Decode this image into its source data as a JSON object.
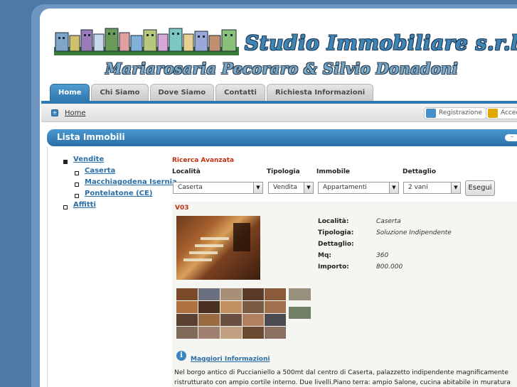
{
  "header": {
    "title": "Studio Immobiliare s.r.l.",
    "subtitle": "Mariarosaria Pecoraro & Silvio Donadoni"
  },
  "tabs": [
    {
      "label": "Home",
      "active": true
    },
    {
      "label": "Chi Siamo"
    },
    {
      "label": "Dove Siamo"
    },
    {
      "label": "Contatti"
    },
    {
      "label": "Richiesta Informazioni"
    }
  ],
  "breadcrumb": {
    "home": "Home"
  },
  "user_actions": {
    "register": "Registrazione",
    "access": "Accedi"
  },
  "section": {
    "title": "Lista Immobili",
    "collapse": "–"
  },
  "tree": {
    "vendite": "Vendite",
    "vendite_children": [
      "Caserta",
      "Macchiagodena Isernia",
      "Pontelatone (CE)"
    ],
    "affitti": "Affitti"
  },
  "search": {
    "heading": "Ricerca Avanzata",
    "labels": {
      "localita": "Località",
      "tipologia": "Tipologia",
      "immobile": "Immobile",
      "dettaglio": "Dettaglio"
    },
    "values": {
      "localita": "Caserta",
      "tipologia": "Vendita",
      "immobile": "Appartamenti",
      "dettaglio": "2 vani"
    },
    "submit": "Esegui"
  },
  "listing": {
    "code": "V03",
    "details": [
      {
        "label": "Località:",
        "value": "Caserta"
      },
      {
        "label": "Tipologia:",
        "value": "Soluzione Indipendente"
      },
      {
        "label": "Dettaglio:",
        "value": ""
      },
      {
        "label": "Mq:",
        "value": "360"
      },
      {
        "label": "Importo:",
        "value": "800.000"
      }
    ],
    "more_info": "Maggiori Informazioni",
    "description": "Nel borgo antico di Puccianiello a 500mt dal centro di Caserta, palazzetto indipendente magnificamente ristrutturato con ampio cortile interno. Due livelli.Piano terra: ampio Salone, cucina abitabile in muratura con camino, un bagno, ingresso con"
  },
  "colors": {
    "accent": "#2f78b0",
    "link": "#2a6ea6",
    "code_red": "#c03010",
    "page_bg": "#4d79a8"
  },
  "icons": [
    "home-icon",
    "register-icon",
    "lock-icon",
    "collapse-icon",
    "info-icon"
  ]
}
